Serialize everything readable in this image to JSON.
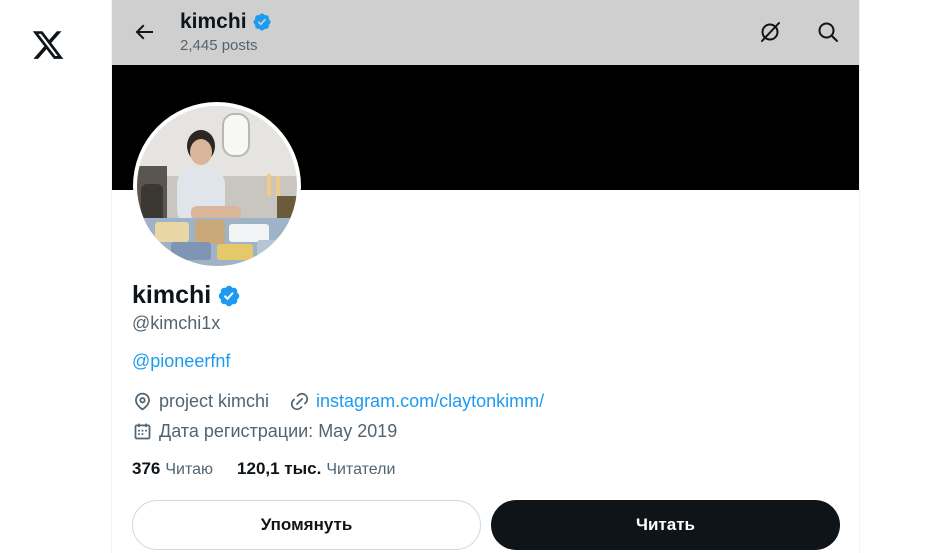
{
  "topbar": {
    "name": "kimchi",
    "posts": "2,445 posts"
  },
  "profile": {
    "name": "kimchi",
    "handle": "@kimchi1x",
    "bio_link": "@pioneerfnf",
    "location": "project kimchi",
    "website": "instagram.com/claytonkimm/",
    "joined": "Дата регистрации: May 2019"
  },
  "stats": {
    "following_count": "376",
    "following_label": "Читаю",
    "followers_count": "120,1 тыс.",
    "followers_label": "Читатели"
  },
  "actions": {
    "mention_label": "Упомянуть",
    "follow_label": "Читать"
  },
  "icons": {
    "logo": "x-logo-icon",
    "back": "arrow-left-icon",
    "grok": "grok-icon",
    "search": "search-icon",
    "verified": "verified-badge-icon",
    "location": "location-pin-icon",
    "link": "link-icon",
    "calendar": "calendar-icon"
  },
  "colors": {
    "accent": "#1d9bf0",
    "text": "#0f1419",
    "secondary": "#536471",
    "topbar": "#cfcfcf",
    "banner": "#000000"
  }
}
